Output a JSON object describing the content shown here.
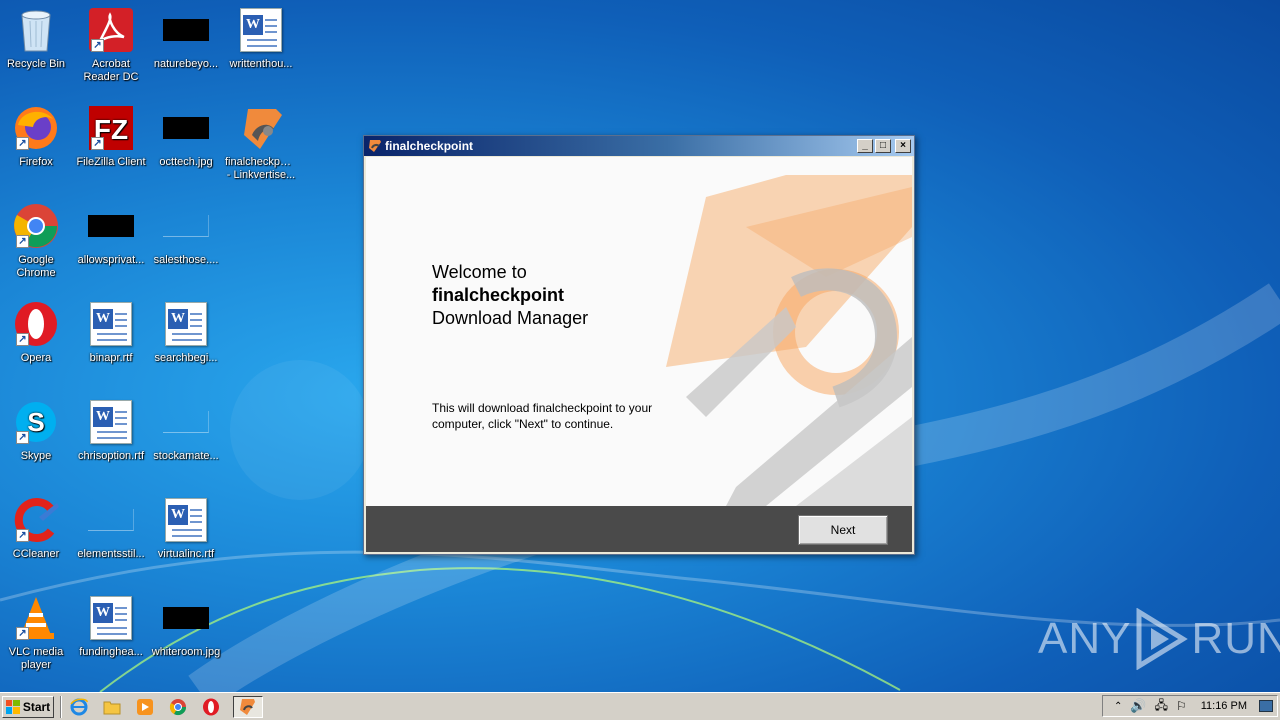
{
  "desktop": {
    "icons": [
      {
        "label": "Recycle Bin",
        "label2": ""
      },
      {
        "label": "Acrobat",
        "label2": "Reader DC"
      },
      {
        "label": "naturebeyo...",
        "label2": ""
      },
      {
        "label": "writtenthou...",
        "label2": ""
      },
      {
        "label": "Firefox",
        "label2": ""
      },
      {
        "label": "FileZilla Client",
        "label2": ""
      },
      {
        "label": "octtech.jpg",
        "label2": ""
      },
      {
        "label": "finalcheckpoint",
        "label2": "- Linkvertise..."
      },
      {
        "label": "Google",
        "label2": "Chrome"
      },
      {
        "label": "allowsprivat...",
        "label2": ""
      },
      {
        "label": "salesthose....",
        "label2": ""
      },
      {
        "label": "Opera",
        "label2": ""
      },
      {
        "label": "binapr.rtf",
        "label2": ""
      },
      {
        "label": "searchbegi...",
        "label2": ""
      },
      {
        "label": "Skype",
        "label2": ""
      },
      {
        "label": "chrisoption.rtf",
        "label2": ""
      },
      {
        "label": "stockamate...",
        "label2": ""
      },
      {
        "label": "CCleaner",
        "label2": ""
      },
      {
        "label": "elementsstil...",
        "label2": ""
      },
      {
        "label": "virtualinc.rtf",
        "label2": ""
      },
      {
        "label": "VLC media",
        "label2": "player"
      },
      {
        "label": "fundinghea...",
        "label2": ""
      },
      {
        "label": "whiteroom.jpg",
        "label2": ""
      }
    ]
  },
  "window": {
    "title": "finalcheckpoint",
    "min": "_",
    "max": "□",
    "close": "×",
    "welcome_line1": "Welcome to",
    "welcome_line2": "finalcheckpoint",
    "welcome_line3": "Download Manager",
    "description": "This will download finalcheckpoint to your computer, click \"Next\" to continue.",
    "next_label": "Next"
  },
  "taskbar": {
    "start_label": "Start",
    "clock": "11:16 PM"
  },
  "watermark": {
    "left": "ANY",
    "right": "RUN"
  },
  "colors": {
    "accent_orange": "#f7a35c",
    "swirl_gray": "#c8c8c8"
  }
}
